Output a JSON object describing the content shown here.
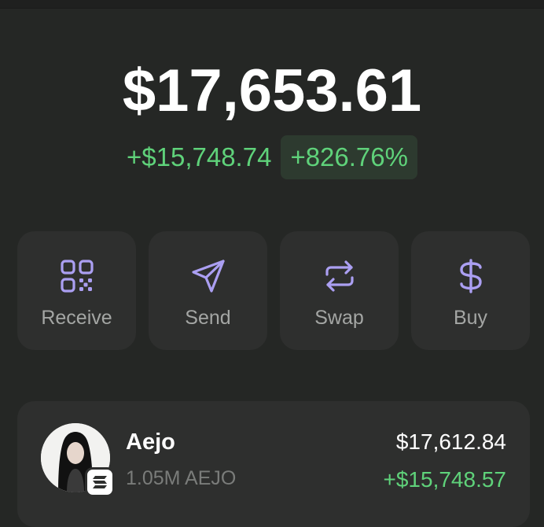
{
  "wallet": {
    "balance": "$17,653.61",
    "change_amount": "+$15,748.74",
    "change_percent": "+826.76%"
  },
  "actions": [
    {
      "label": "Receive",
      "icon": "qr-code-icon"
    },
    {
      "label": "Send",
      "icon": "send-icon"
    },
    {
      "label": "Swap",
      "icon": "swap-icon"
    },
    {
      "label": "Buy",
      "icon": "dollar-icon"
    }
  ],
  "assets": [
    {
      "name": "Aejo",
      "quantity": "1.05M AEJO",
      "value": "$17,612.84",
      "gain": "+$15,748.57",
      "chain_icon": "solana-icon"
    }
  ],
  "colors": {
    "background": "#252725",
    "card": "#2e2f2e",
    "positive": "#5fd27a",
    "accent": "#ab9ff2"
  }
}
